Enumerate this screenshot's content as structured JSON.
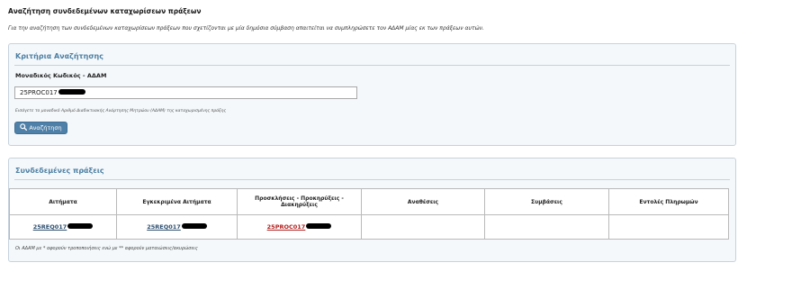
{
  "page": {
    "title": "Αναζήτηση συνδεδεμένων καταχωρίσεων πράξεων",
    "intro": "Για την αναζήτηση των συνδεδεμένων καταχωρίσεων πράξεων που σχετίζονται με μία δημόσια σύμβαση απαιτείται να συμπληρώσετε τον ΑΔΑΜ μίας εκ των πράξεων αυτών."
  },
  "criteria": {
    "title": "Κριτήρια Αναζήτησης",
    "field_label": "Μοναδικός Κωδικός - ΑΔΑΜ",
    "field_value": "25PROC017",
    "field_help": "Εισάγετε το μοναδικό Αριθμό Διαδικτυακής Ανάρτησης Μητρώου (ΑΔΑΜ) της καταχωρισμένης πράξης",
    "search_label": "Αναζήτηση",
    "search_icon": "search-icon"
  },
  "linked": {
    "title": "Συνδεδεμένες πράξεις",
    "headers": [
      "Αιτήματα",
      "Εγκεκριμένα Αιτήματα",
      "Προσκλήσεις - Προκηρύξεις - Διακηρύξεις",
      "Αναθέσεις",
      "Συμβάσεις",
      "Εντολές Πληρωμών"
    ],
    "row": [
      "25REQ017",
      "25REQ017",
      "25PROC017",
      "",
      "",
      ""
    ],
    "note": "Οι ΑΔΑΜ με * αφορούν τροποποιήσεις ενώ με ** αφορούν ματαιώσεις/ακυρώσεις"
  },
  "colors": {
    "panel_title": "#4d7fa3",
    "button": "#4f80a8",
    "link": "#2c4f70",
    "link_highlight": "#b21d1d"
  }
}
